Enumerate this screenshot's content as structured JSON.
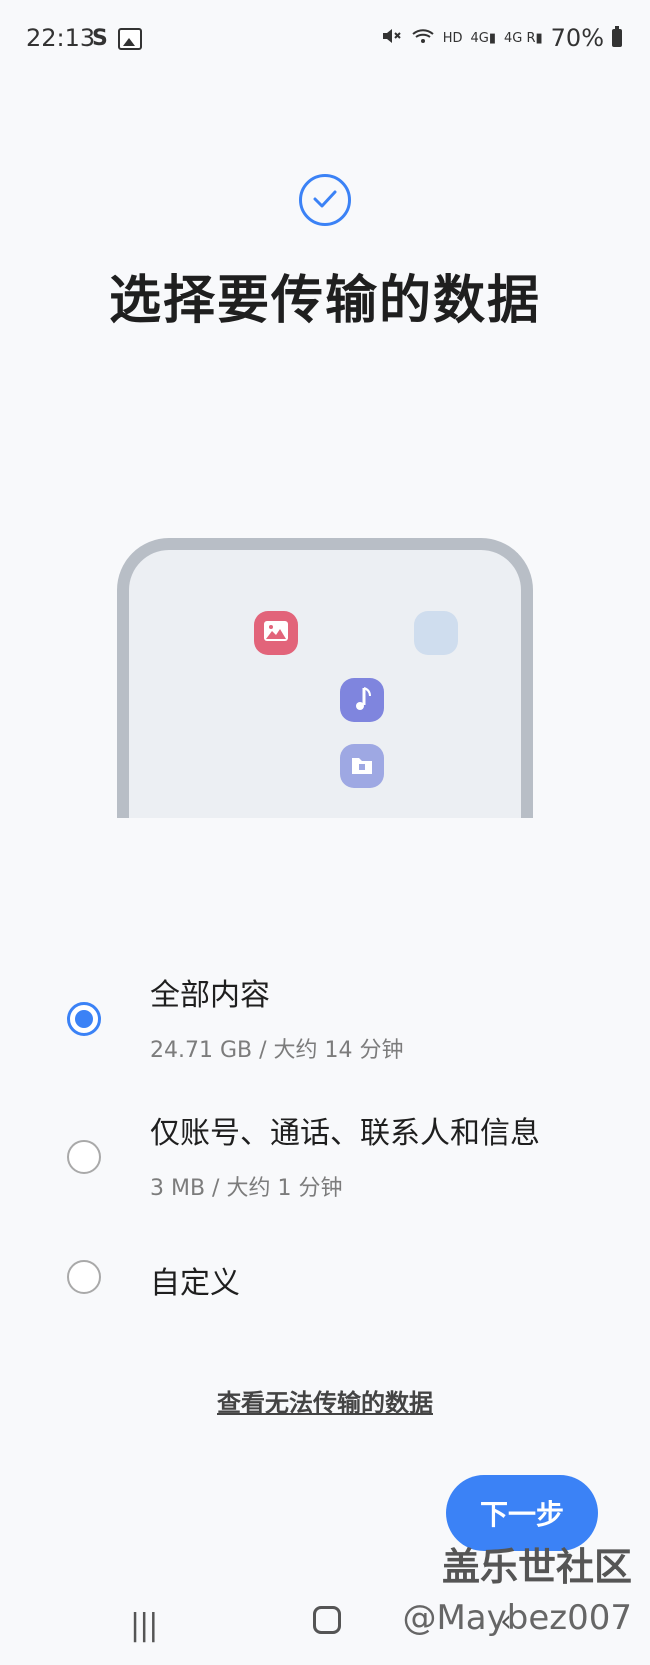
{
  "status_bar": {
    "time": "22:13",
    "left_icons": [
      "s-logo-icon",
      "image-icon"
    ],
    "right_icons": [
      "mute-icon",
      "wifi-icon",
      "hd-icon",
      "signal-4g-icon",
      "signal-4g-r-icon"
    ],
    "battery": "70%"
  },
  "header": {
    "title": "选择要传输的数据"
  },
  "options": [
    {
      "label": "全部内容",
      "detail": "24.71 GB / 大约 14 分钟",
      "selected": true
    },
    {
      "label": "仅账号、通话、联系人和信息",
      "detail": "3 MB / 大约 1 分钟",
      "selected": false
    },
    {
      "label": "自定义",
      "detail": "",
      "selected": false
    }
  ],
  "link": {
    "label": "查看无法传输的数据"
  },
  "next_button": {
    "label": "下一步"
  },
  "watermark": {
    "site": "盖乐世社区",
    "user": "@Maybez007"
  },
  "icons": {
    "check": "check-circle-icon",
    "photo": "photo-icon",
    "music": "music-note-icon",
    "folder": "folder-icon"
  },
  "colors": {
    "accent": "#3b82f6",
    "photo_app": "#e2647a",
    "music_app": "#7f85de",
    "folder_app": "#9ea8e3"
  }
}
